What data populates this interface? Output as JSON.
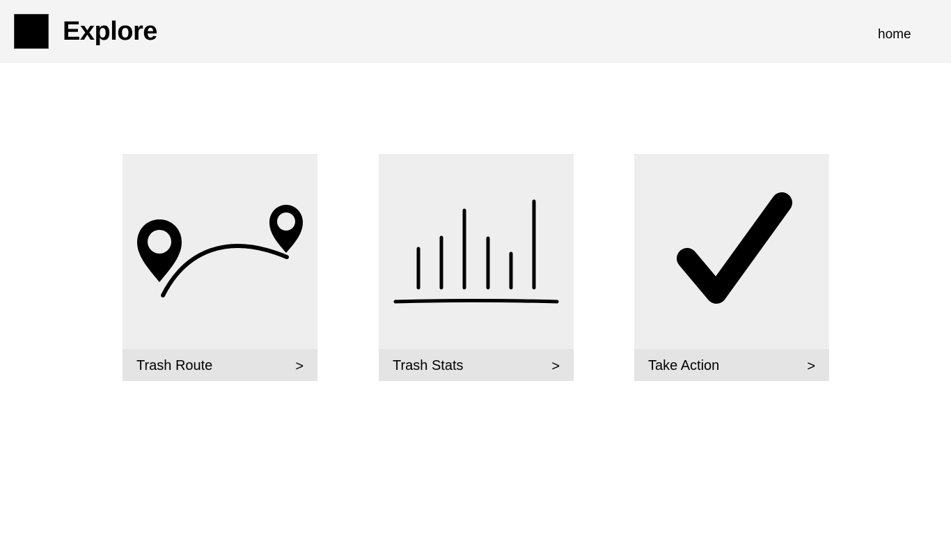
{
  "header": {
    "logo": "logo-square",
    "title": "Explore",
    "nav": {
      "home_label": "home"
    }
  },
  "cards": [
    {
      "label": "Trash Route",
      "arrow": ">",
      "icon": "map-route-icon"
    },
    {
      "label": "Trash Stats",
      "arrow": ">",
      "icon": "bar-chart-icon"
    },
    {
      "label": "Take Action",
      "arrow": ">",
      "icon": "checkmark-icon"
    }
  ],
  "colors": {
    "header_bg": "#f4f4f4",
    "card_bg": "#eeeeee",
    "card_footer_bg": "#e4e4e4",
    "icon": "#000000"
  }
}
